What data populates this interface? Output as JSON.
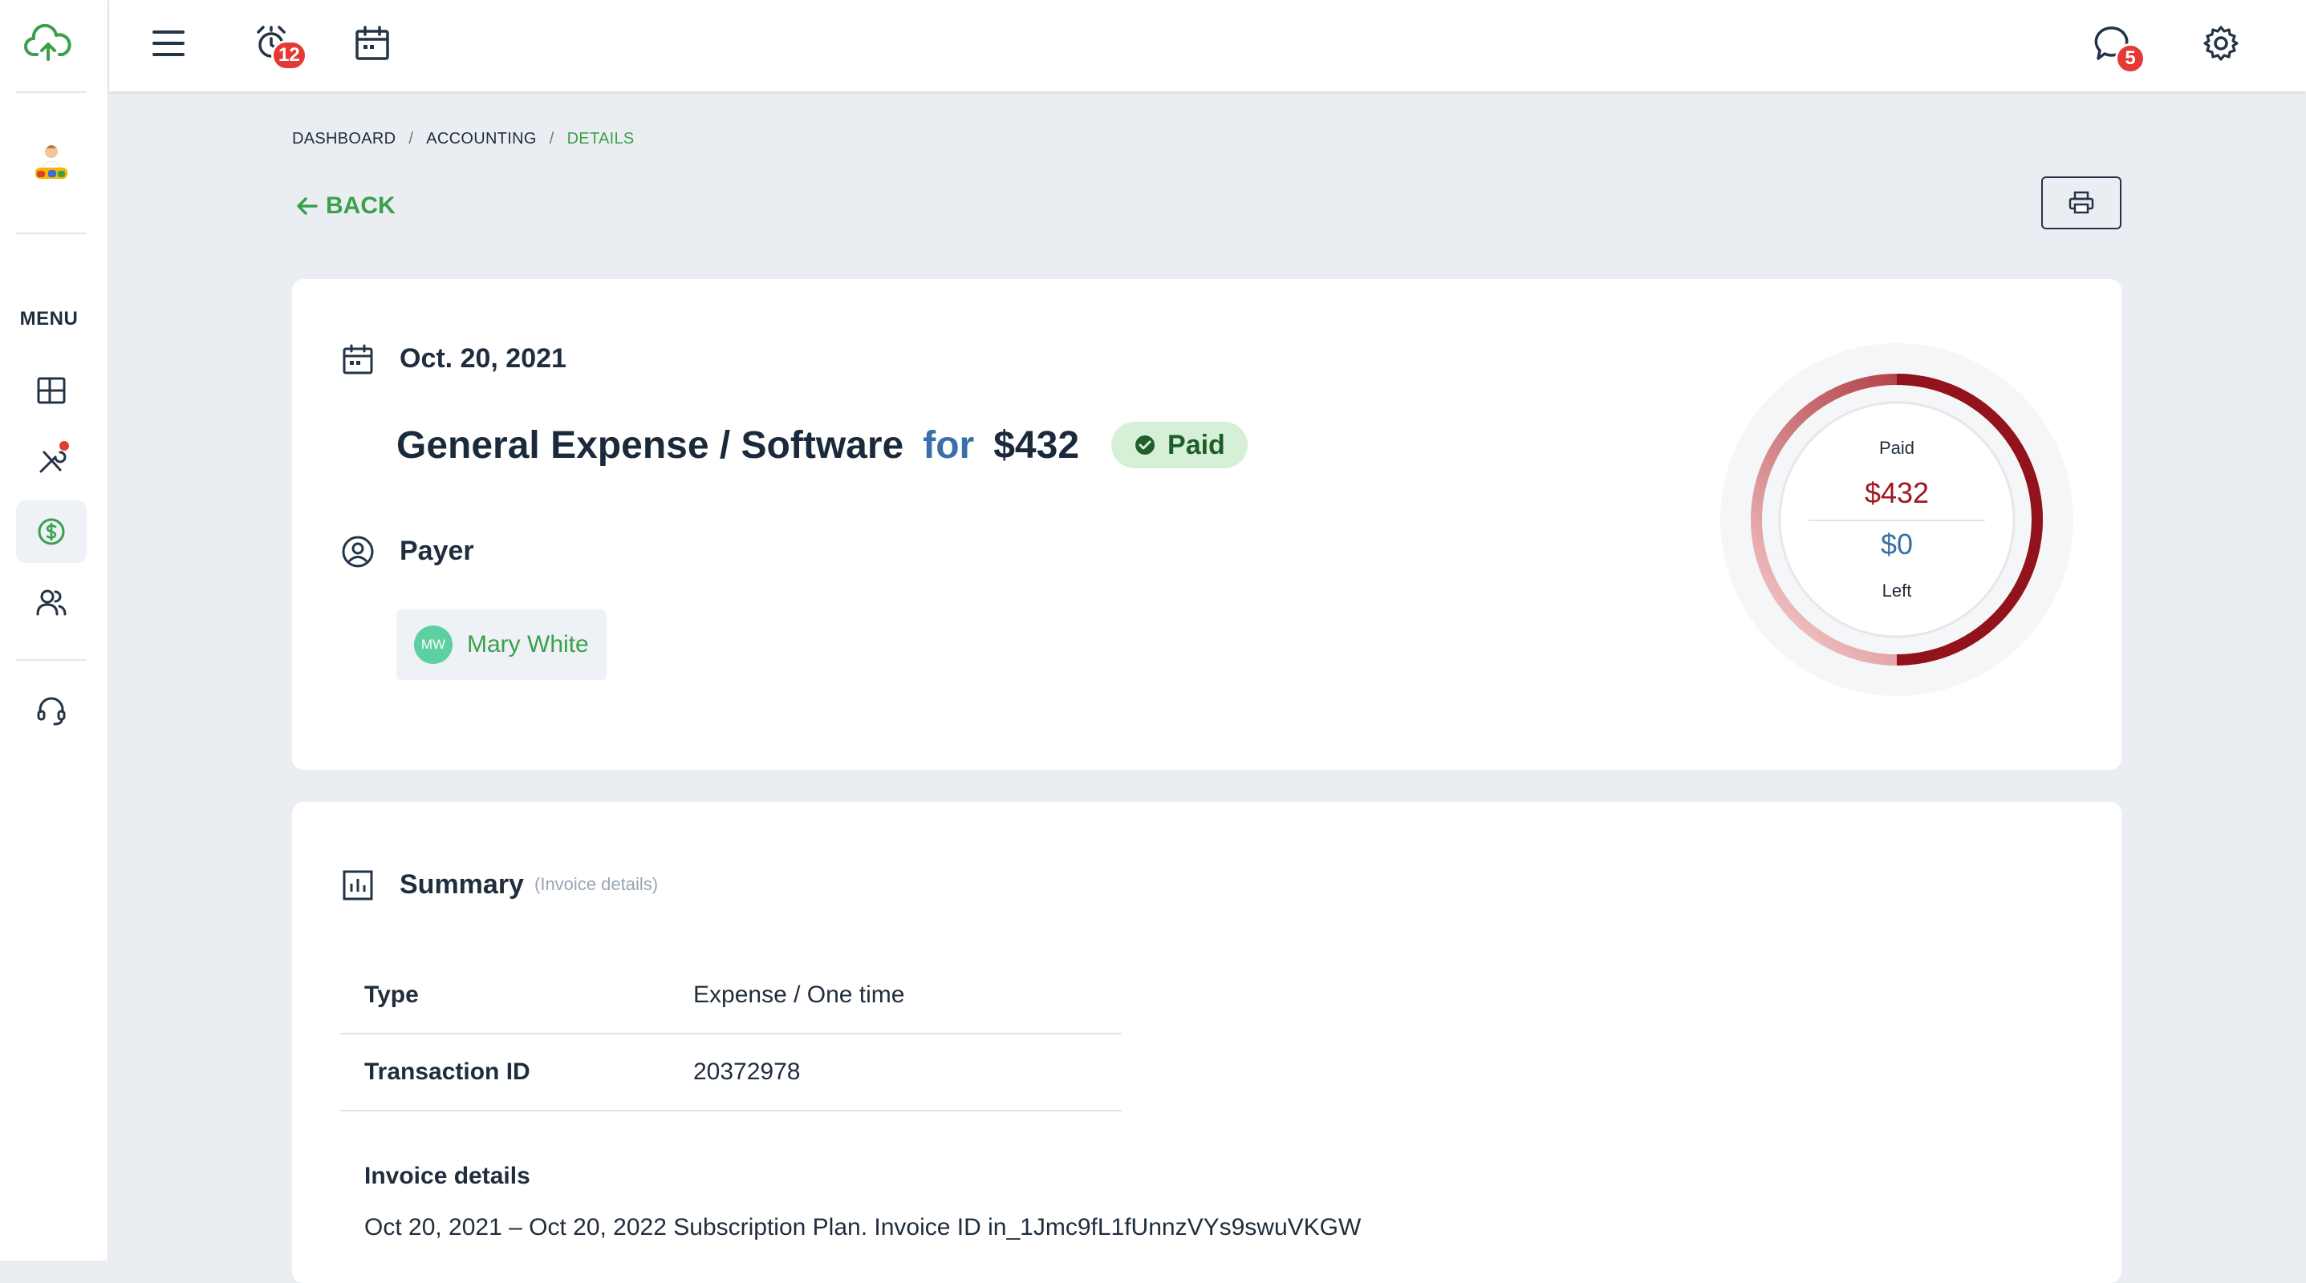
{
  "sidebar": {
    "menu_label": "MENU"
  },
  "topbar": {
    "alarm_badge": "12",
    "chat_badge": "5"
  },
  "breadcrumb": {
    "items": [
      "DASHBOARD",
      "ACCOUNTING",
      "DETAILS"
    ],
    "separator": "/"
  },
  "back_label": "BACK",
  "transaction": {
    "date": "Oct. 20, 2021",
    "title": "General Expense / Software",
    "for_label": "for",
    "amount": "$432",
    "status": "Paid",
    "payer_label": "Payer",
    "payer": {
      "initials": "MW",
      "name": "Mary White"
    }
  },
  "gauge": {
    "paid_label": "Paid",
    "paid_amount": "$432",
    "left_amount": "$0",
    "left_label": "Left",
    "paid_fraction": 1.0
  },
  "summary": {
    "title": "Summary",
    "subtitle": "(Invoice details)",
    "rows": [
      {
        "key": "Type",
        "value": "Expense / One time"
      },
      {
        "key": "Transaction ID",
        "value": "20372978"
      }
    ],
    "invoice_label": "Invoice details",
    "invoice_text": "Oct 20, 2021 – Oct 20, 2022 Subscription Plan. Invoice ID in_1Jmc9fL1fUnnzVYs9swuVKGW"
  },
  "colors": {
    "accent_green": "#3aa04a",
    "accent_blue": "#3a6fa8",
    "paid_red": "#a01822",
    "badge_red": "#e53935",
    "paid_pill_bg": "#d5f0d7"
  },
  "icons": {
    "logo": "cloud-upload-icon",
    "menu": "hamburger-icon",
    "alarm": "alarm-clock-icon",
    "calendar": "calendar-icon",
    "chat": "chat-bubble-icon",
    "settings": "gear-icon",
    "print": "printer-icon",
    "back": "arrow-left-icon"
  }
}
